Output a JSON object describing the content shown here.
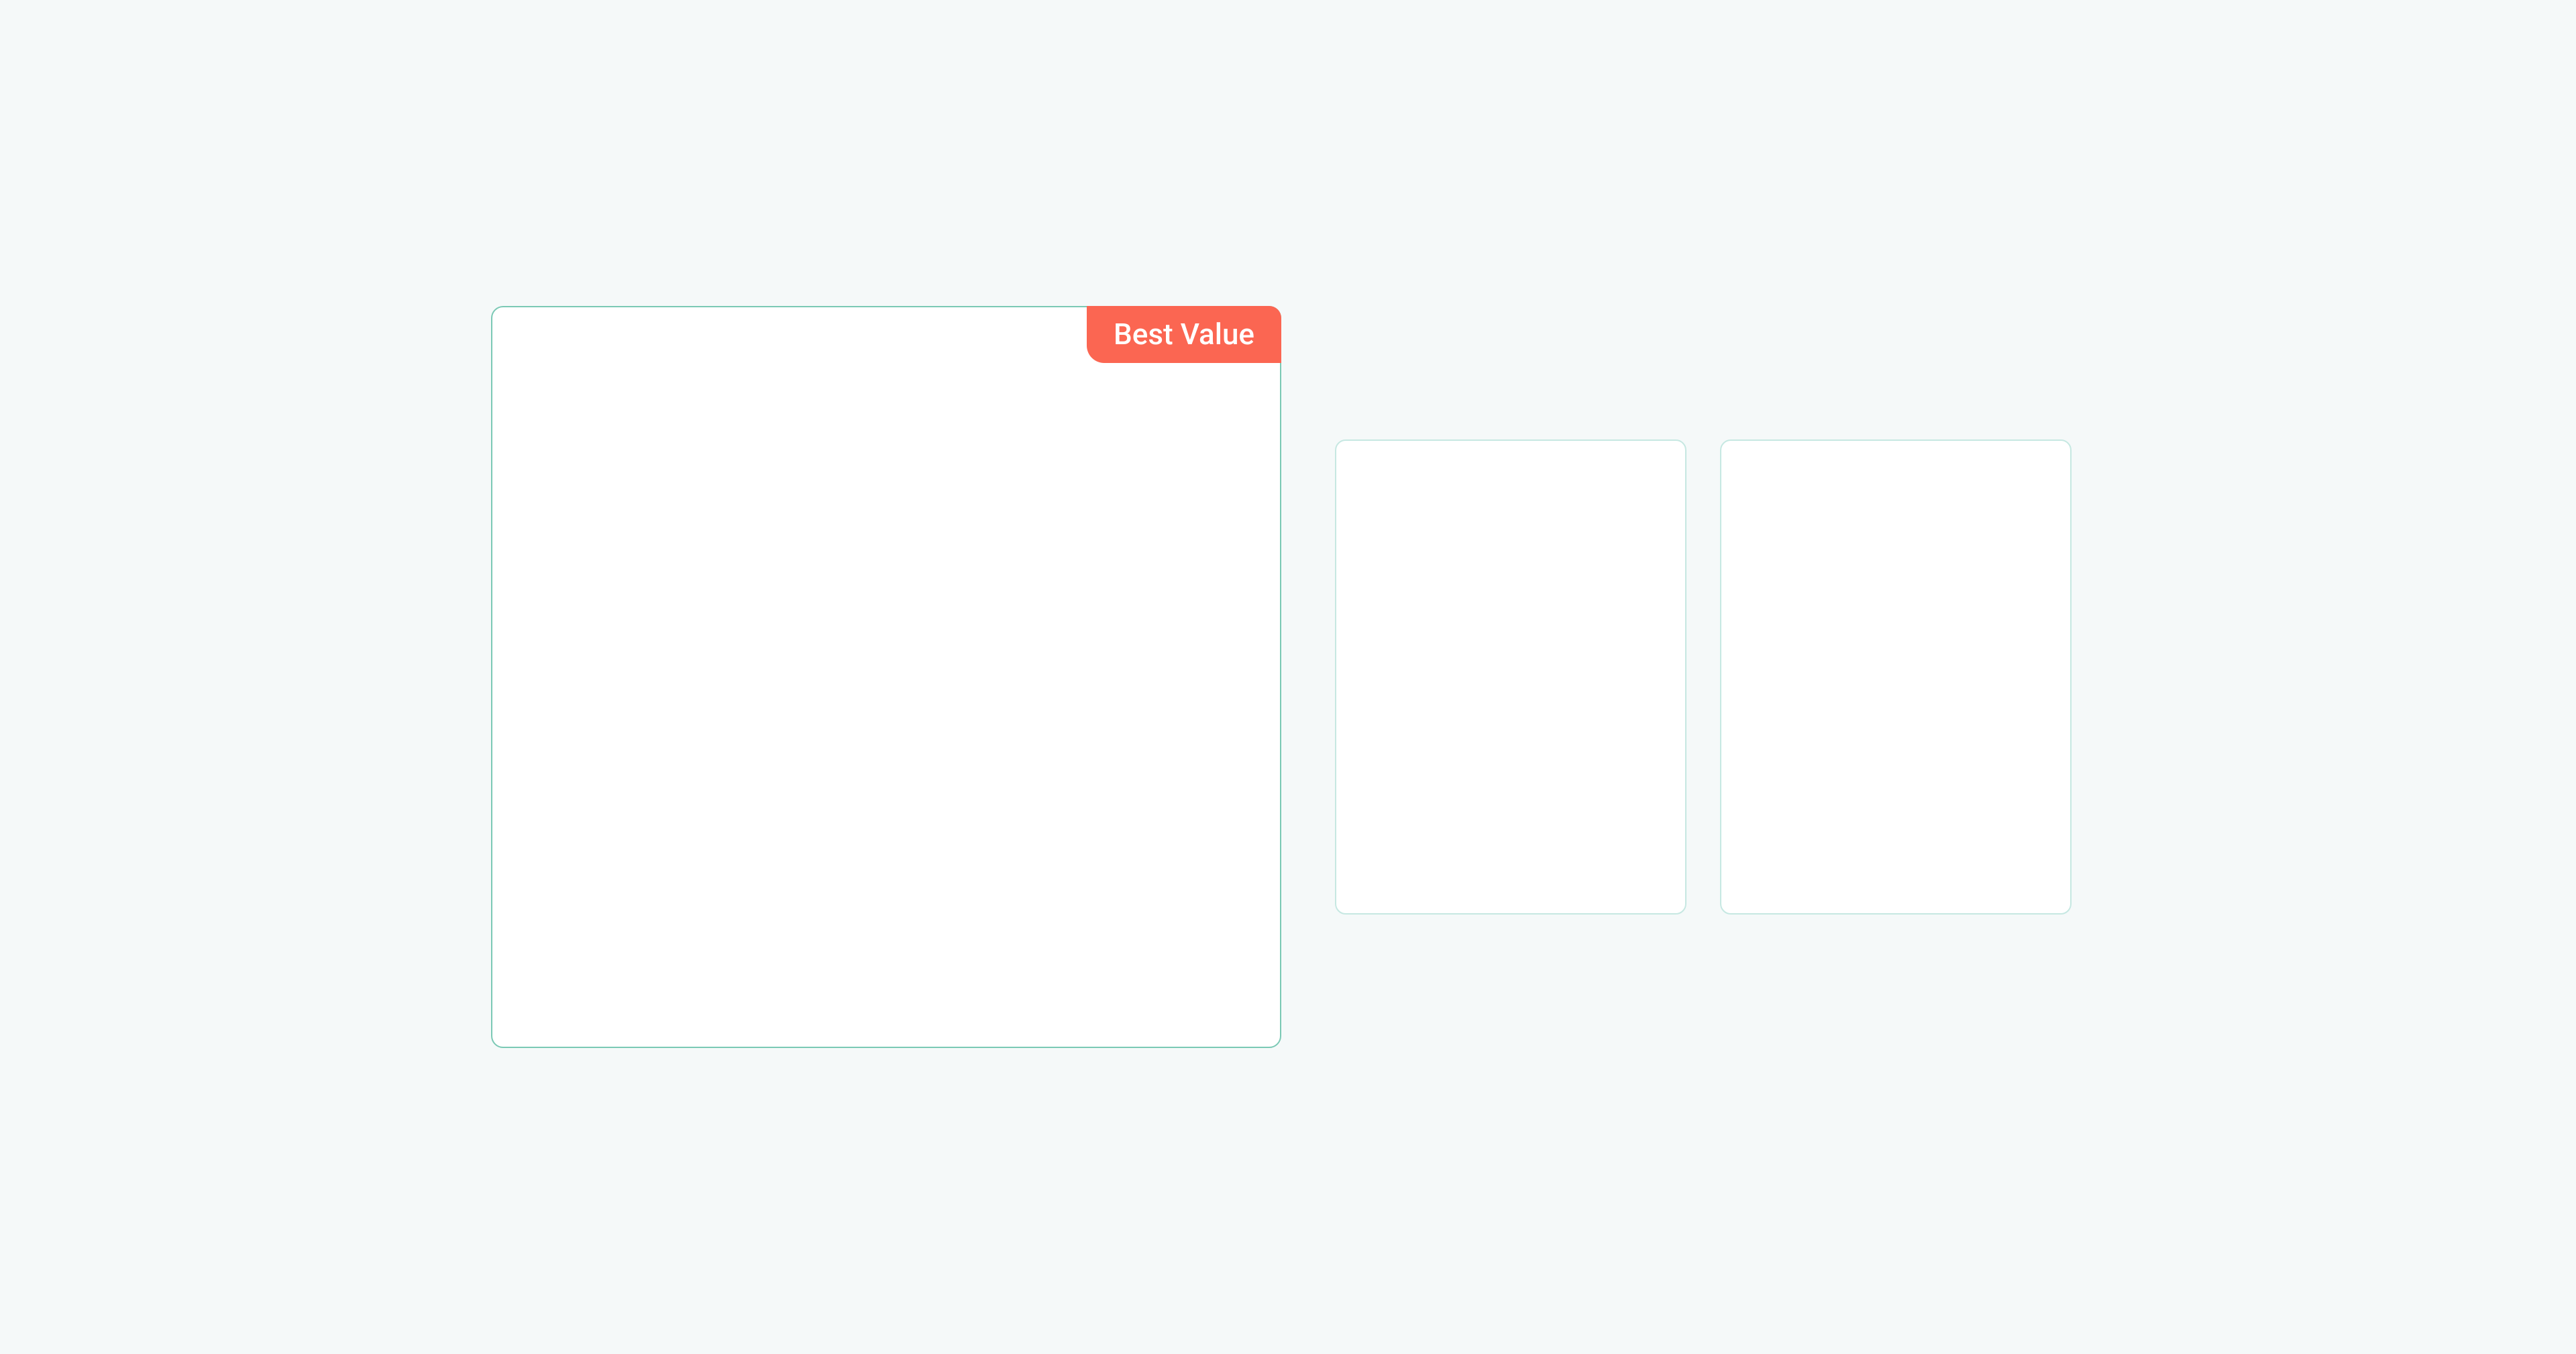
{
  "badge": {
    "label": "Best Value"
  },
  "colors": {
    "background": "#f5f9f9",
    "cardBackground": "#ffffff",
    "featuredBorder": "#7bc9b5",
    "secondaryBorder": "#c6e8e2",
    "badgeBackground": "#fb6652",
    "badgeText": "#ffffff"
  }
}
